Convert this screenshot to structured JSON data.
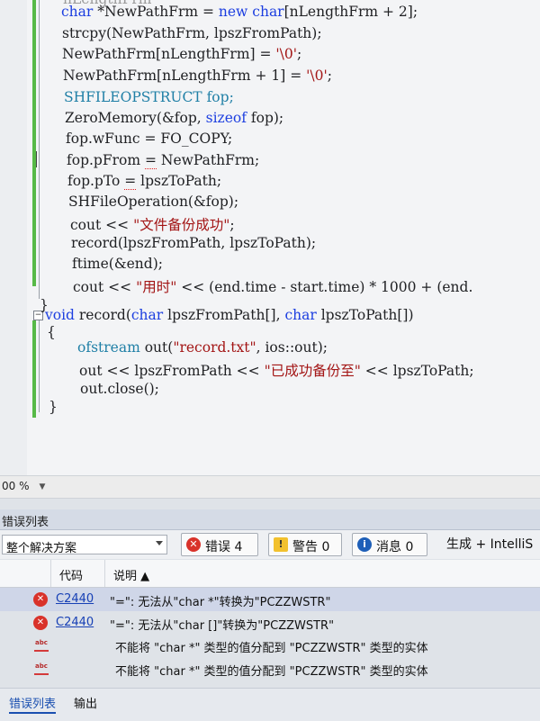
{
  "editor": {
    "lines": [
      "nLengthFrm",
      "char *NewPathFrm = new char[nLengthFrm + 2];",
      "strcpy(NewPathFrm, lpszFromPath);",
      "NewPathFrm[nLengthFrm] = '\\0';",
      "NewPathFrm[nLengthFrm + 1] = '\\0';",
      "SHFILEOPSTRUCT fop;",
      "ZeroMemory(&fop, sizeof fop);",
      "fop.wFunc = FO_COPY;",
      "fop.pFrom = NewPathFrm;",
      "fop.pTo = lpszToPath;",
      "SHFileOperation(&fop);",
      "cout << \"文件备份成功\";",
      "record(lpszFromPath, lpszToPath);",
      "ftime(&end);",
      "cout << \"用时\" << (end.time - start.time) * 1000 + (end.",
      "}",
      "void record(char lpszFromPath[], char lpszToPath[])",
      "{",
      "ofstream out(\"record.txt\", ios::out);",
      "out << lpszFromPath << \"已成功备份至\" << lpszToPath;",
      "out.close();",
      "}"
    ]
  },
  "zoom": {
    "value": "00 %"
  },
  "error_list": {
    "title": "错误列表",
    "scope": "整个解决方案",
    "filters": {
      "errors": "错误 4",
      "warnings": "警告 0",
      "messages": "消息 0"
    },
    "build_filter": "生成 + IntelliS",
    "columns": {
      "code": "代码",
      "description": "说明 ▲"
    },
    "rows": [
      {
        "code": "C2440",
        "desc": "\"=\": 无法从\"char *\"转换为\"PCZZWSTR\""
      },
      {
        "code": "C2440",
        "desc": "\"=\": 无法从\"char []\"转换为\"PCZZWSTR\""
      },
      {
        "code": "",
        "desc": "不能将 \"char *\" 类型的值分配到 \"PCZZWSTR\" 类型的实体"
      },
      {
        "code": "",
        "desc": "不能将 \"char *\" 类型的值分配到 \"PCZZWSTR\" 类型的实体"
      }
    ],
    "icon_abc_text": "abc"
  },
  "bottom_tabs": {
    "error_list": "错误列表",
    "output": "输出"
  },
  "icons": {
    "error": "error-icon",
    "warning": "warning-icon",
    "info": "info-icon",
    "intellisense": "intellisense-squiggle-icon"
  },
  "colors": {
    "keyword": "#1c3ee0",
    "type": "#1f7fa6",
    "string": "#a31515",
    "change_bar": "#57b947",
    "error_red": "#d9322a"
  }
}
